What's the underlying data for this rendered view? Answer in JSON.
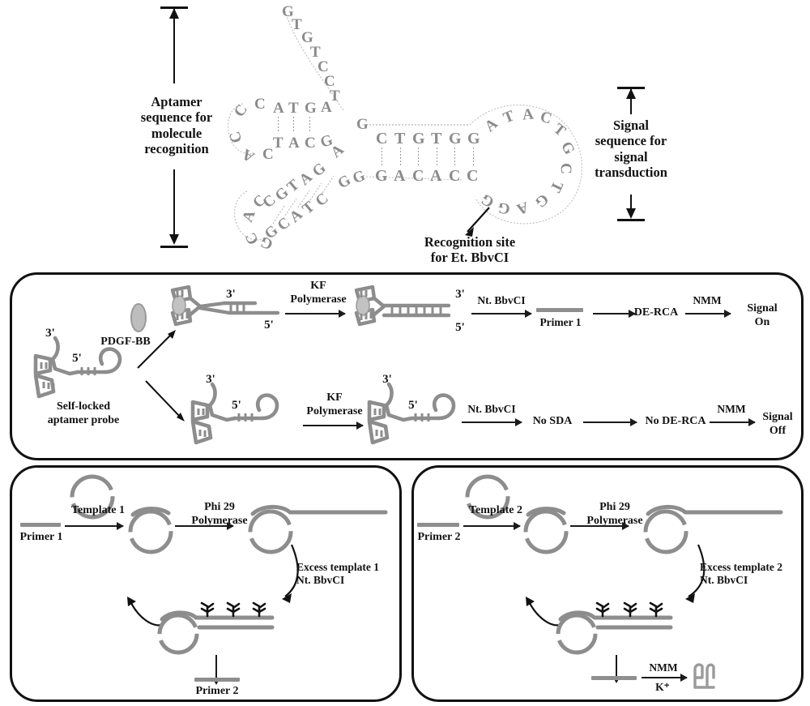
{
  "figure": {
    "title": "Self-locked aptamer probe / dual-enhanced rolling circle amplification scheme",
    "type": "diagram"
  },
  "top_section": {
    "left_label": "Aptamer\nsequence for\nmolecule\nrecognition",
    "left_label_lines": [
      "Aptamer",
      "sequence for",
      "molecule",
      "recognition"
    ],
    "right_label_lines": [
      "Signal",
      "sequence for",
      "signal",
      "transduction"
    ],
    "recognition_label_lines": [
      "Recognition site",
      "for Et. BbvCI"
    ],
    "sequences": {
      "upper_stem_top_strand": [
        "A",
        "T",
        "G",
        "A"
      ],
      "upper_stem_bottom_strand": [
        "T",
        "A",
        "C",
        "G"
      ],
      "upper_tail_ascending": [
        "G",
        "T",
        "G",
        "T",
        "C",
        "C",
        "T"
      ],
      "left_loop_bases": [
        "C",
        "C",
        "C",
        "A",
        "C"
      ],
      "lower_stem_top_strand": [
        "C",
        "G",
        "T",
        "A",
        "G"
      ],
      "lower_stem_bottom_strand": [
        "G",
        "C",
        "A",
        "T",
        "C"
      ],
      "lower_loop_bases": [
        "C",
        "A",
        "C",
        "G",
        "G"
      ],
      "duplex_top_strand": [
        "C",
        "T",
        "G",
        "T",
        "G",
        "G"
      ],
      "duplex_bottom_strand": [
        "G",
        "A",
        "C",
        "A",
        "C",
        "C"
      ],
      "duplex_flank_left_top": "G",
      "duplex_flank_left_bottom": "G",
      "duplex_flank_right_top": "G",
      "duplex_flank_right_bottom": "G",
      "loop_bases_clockwise": [
        "A",
        "T",
        "A",
        "C",
        "T",
        "G",
        "C",
        "T",
        "G",
        "A",
        "G",
        "G"
      ]
    }
  },
  "middle_panel": {
    "probe_label_lines": [
      "Self-locked",
      "aptamer probe"
    ],
    "probe_end_3": "3'",
    "probe_end_5": "5'",
    "protein_label": "PDGF-BB",
    "upper_path": {
      "bound_end_3": "3'",
      "bound_end_5": "5'",
      "step1_enzyme_lines": [
        "KF",
        "Polymerase"
      ],
      "extended_end_3": "3'",
      "extended_end_5": "5'",
      "step2_enzyme": "Nt. BbvCI",
      "product_label": "Primer 1",
      "step3_label": "DE-RCA",
      "step4_enzyme": "NMM",
      "result_lines": [
        "Signal",
        "On"
      ]
    },
    "lower_path": {
      "free_end_3": "3'",
      "free_end_5": "5'",
      "step1_enzyme_lines": [
        "KF",
        "Polymerase"
      ],
      "after_end_3": "3'",
      "after_end_5": "5'",
      "step2_enzyme": "Nt. BbvCI",
      "step2_result": "No SDA",
      "step3_result": "No DE-RCA",
      "step4_enzyme": "NMM",
      "result_lines": [
        "Signal",
        "Off"
      ]
    }
  },
  "bottom_left_panel": {
    "primer_in": "Primer 1",
    "template_label": "Template 1",
    "polymerase_lines": [
      "Phi 29",
      "Polymerase"
    ],
    "excess_lines": [
      "Excess template 1",
      "Nt. BbvCI"
    ],
    "primer_out": "Primer 2"
  },
  "bottom_right_panel": {
    "primer_in": "Primer 2",
    "template_label": "Template 2",
    "polymerase_lines": [
      "Phi 29",
      "Polymerase"
    ],
    "excess_lines": [
      "Excess template 2",
      "Nt. BbvCI"
    ],
    "nmm_label": "NMM",
    "potassium_label": "K⁺",
    "gquadruplex_name": "g-quadruplex-icon"
  },
  "colors": {
    "ink": "#111111",
    "dna_grey": "#8e8e8e",
    "base_grey": "#8b8b8b",
    "panel_border": "#111111"
  }
}
